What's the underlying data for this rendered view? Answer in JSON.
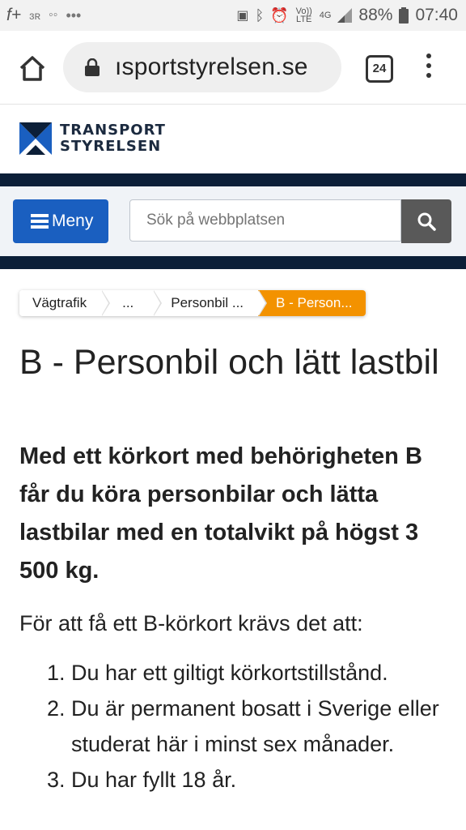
{
  "status_bar": {
    "left_text": "f+",
    "volte_label": "Vo)) LTE",
    "network_label": "4G",
    "battery": "88%",
    "time": "07:40"
  },
  "browser": {
    "url": "ısportstyrelsen.se",
    "tab_count": "24"
  },
  "site": {
    "logo_line1": "TRANSPORT",
    "logo_line2": "STYRELSEN",
    "menu_label": "Meny",
    "search_placeholder": "Sök på webbplatsen"
  },
  "breadcrumb": [
    {
      "label": "Vägtrafik"
    },
    {
      "label": "..."
    },
    {
      "label": "Personbil ..."
    },
    {
      "label": "B - Person..."
    }
  ],
  "content": {
    "title": "B - Personbil och lätt lastbil",
    "lead": "Med ett körkort med behörigheten B får du köra personbilar och lätta lastbilar med en totalvikt på högst 3 500 kg.",
    "intro": "För att få ett B-körkort krävs det att:",
    "requirements": [
      "Du har ett giltigt körkortstillstånd.",
      "Du är permanent bosatt i Sverige eller studerat här i minst sex månader.",
      "Du har fyllt 18 år."
    ]
  },
  "colors": {
    "navy": "#0c1f38",
    "menu_blue": "#1a5fc0",
    "breadcrumb_active": "#f39200",
    "search_button": "#595959"
  }
}
